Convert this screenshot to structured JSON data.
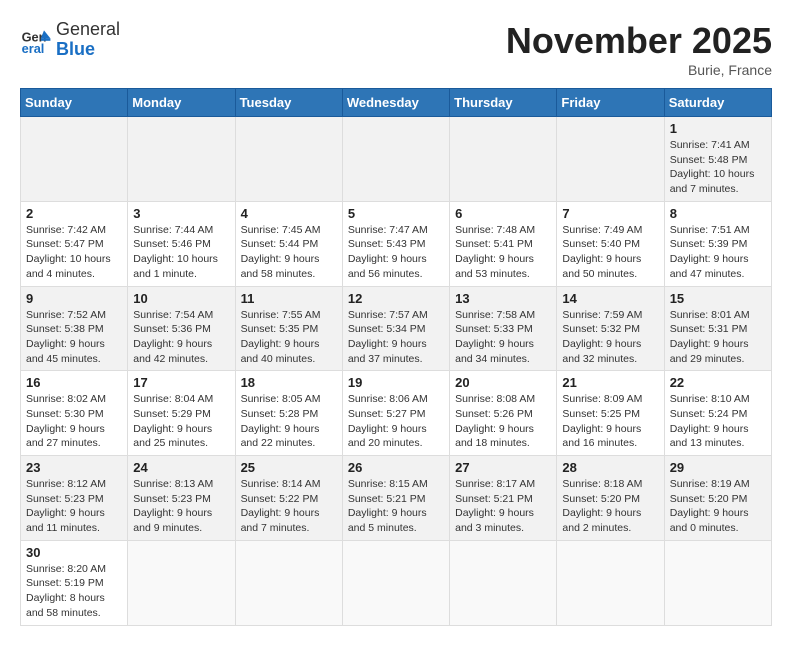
{
  "header": {
    "logo_general": "General",
    "logo_blue": "Blue",
    "month_title": "November 2025",
    "location": "Burie, France"
  },
  "weekdays": [
    "Sunday",
    "Monday",
    "Tuesday",
    "Wednesday",
    "Thursday",
    "Friday",
    "Saturday"
  ],
  "weeks": [
    [
      {
        "day": "",
        "info": ""
      },
      {
        "day": "",
        "info": ""
      },
      {
        "day": "",
        "info": ""
      },
      {
        "day": "",
        "info": ""
      },
      {
        "day": "",
        "info": ""
      },
      {
        "day": "",
        "info": ""
      },
      {
        "day": "1",
        "info": "Sunrise: 7:41 AM\nSunset: 5:48 PM\nDaylight: 10 hours and 7 minutes."
      }
    ],
    [
      {
        "day": "2",
        "info": "Sunrise: 7:42 AM\nSunset: 5:47 PM\nDaylight: 10 hours and 4 minutes."
      },
      {
        "day": "3",
        "info": "Sunrise: 7:44 AM\nSunset: 5:46 PM\nDaylight: 10 hours and 1 minute."
      },
      {
        "day": "4",
        "info": "Sunrise: 7:45 AM\nSunset: 5:44 PM\nDaylight: 9 hours and 58 minutes."
      },
      {
        "day": "5",
        "info": "Sunrise: 7:47 AM\nSunset: 5:43 PM\nDaylight: 9 hours and 56 minutes."
      },
      {
        "day": "6",
        "info": "Sunrise: 7:48 AM\nSunset: 5:41 PM\nDaylight: 9 hours and 53 minutes."
      },
      {
        "day": "7",
        "info": "Sunrise: 7:49 AM\nSunset: 5:40 PM\nDaylight: 9 hours and 50 minutes."
      },
      {
        "day": "8",
        "info": "Sunrise: 7:51 AM\nSunset: 5:39 PM\nDaylight: 9 hours and 47 minutes."
      }
    ],
    [
      {
        "day": "9",
        "info": "Sunrise: 7:52 AM\nSunset: 5:38 PM\nDaylight: 9 hours and 45 minutes."
      },
      {
        "day": "10",
        "info": "Sunrise: 7:54 AM\nSunset: 5:36 PM\nDaylight: 9 hours and 42 minutes."
      },
      {
        "day": "11",
        "info": "Sunrise: 7:55 AM\nSunset: 5:35 PM\nDaylight: 9 hours and 40 minutes."
      },
      {
        "day": "12",
        "info": "Sunrise: 7:57 AM\nSunset: 5:34 PM\nDaylight: 9 hours and 37 minutes."
      },
      {
        "day": "13",
        "info": "Sunrise: 7:58 AM\nSunset: 5:33 PM\nDaylight: 9 hours and 34 minutes."
      },
      {
        "day": "14",
        "info": "Sunrise: 7:59 AM\nSunset: 5:32 PM\nDaylight: 9 hours and 32 minutes."
      },
      {
        "day": "15",
        "info": "Sunrise: 8:01 AM\nSunset: 5:31 PM\nDaylight: 9 hours and 29 minutes."
      }
    ],
    [
      {
        "day": "16",
        "info": "Sunrise: 8:02 AM\nSunset: 5:30 PM\nDaylight: 9 hours and 27 minutes."
      },
      {
        "day": "17",
        "info": "Sunrise: 8:04 AM\nSunset: 5:29 PM\nDaylight: 9 hours and 25 minutes."
      },
      {
        "day": "18",
        "info": "Sunrise: 8:05 AM\nSunset: 5:28 PM\nDaylight: 9 hours and 22 minutes."
      },
      {
        "day": "19",
        "info": "Sunrise: 8:06 AM\nSunset: 5:27 PM\nDaylight: 9 hours and 20 minutes."
      },
      {
        "day": "20",
        "info": "Sunrise: 8:08 AM\nSunset: 5:26 PM\nDaylight: 9 hours and 18 minutes."
      },
      {
        "day": "21",
        "info": "Sunrise: 8:09 AM\nSunset: 5:25 PM\nDaylight: 9 hours and 16 minutes."
      },
      {
        "day": "22",
        "info": "Sunrise: 8:10 AM\nSunset: 5:24 PM\nDaylight: 9 hours and 13 minutes."
      }
    ],
    [
      {
        "day": "23",
        "info": "Sunrise: 8:12 AM\nSunset: 5:23 PM\nDaylight: 9 hours and 11 minutes."
      },
      {
        "day": "24",
        "info": "Sunrise: 8:13 AM\nSunset: 5:23 PM\nDaylight: 9 hours and 9 minutes."
      },
      {
        "day": "25",
        "info": "Sunrise: 8:14 AM\nSunset: 5:22 PM\nDaylight: 9 hours and 7 minutes."
      },
      {
        "day": "26",
        "info": "Sunrise: 8:15 AM\nSunset: 5:21 PM\nDaylight: 9 hours and 5 minutes."
      },
      {
        "day": "27",
        "info": "Sunrise: 8:17 AM\nSunset: 5:21 PM\nDaylight: 9 hours and 3 minutes."
      },
      {
        "day": "28",
        "info": "Sunrise: 8:18 AM\nSunset: 5:20 PM\nDaylight: 9 hours and 2 minutes."
      },
      {
        "day": "29",
        "info": "Sunrise: 8:19 AM\nSunset: 5:20 PM\nDaylight: 9 hours and 0 minutes."
      }
    ],
    [
      {
        "day": "30",
        "info": "Sunrise: 8:20 AM\nSunset: 5:19 PM\nDaylight: 8 hours and 58 minutes."
      },
      {
        "day": "",
        "info": ""
      },
      {
        "day": "",
        "info": ""
      },
      {
        "day": "",
        "info": ""
      },
      {
        "day": "",
        "info": ""
      },
      {
        "day": "",
        "info": ""
      },
      {
        "day": "",
        "info": ""
      }
    ]
  ]
}
